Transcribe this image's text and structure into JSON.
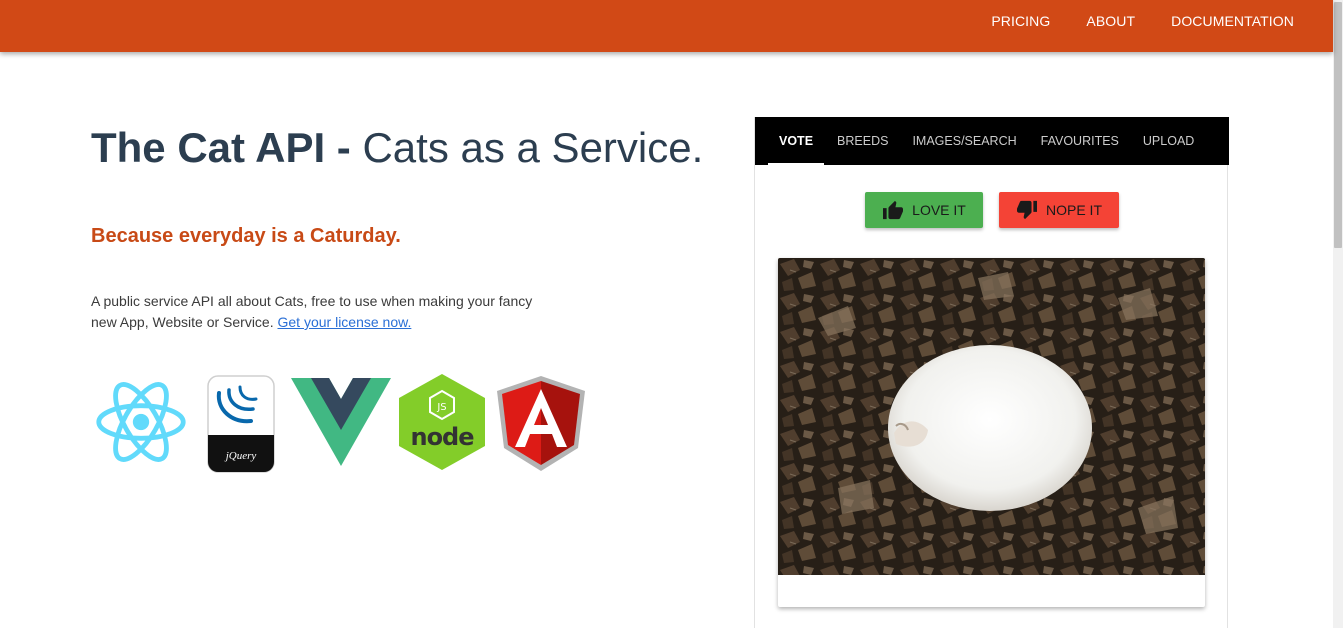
{
  "nav": {
    "items": [
      "PRICING",
      "ABOUT",
      "DOCUMENTATION"
    ]
  },
  "hero": {
    "title_bold": "The Cat API -",
    "title_light": "Cats as a Service.",
    "tagline": "Because everyday is a Caturday.",
    "description": "A public service API all about Cats, free to use when making your fancy new App, Website or Service.",
    "license_link": "Get your license now."
  },
  "logos": [
    "react-icon",
    "jquery-icon",
    "vue-icon",
    "nodejs-icon",
    "angular-icon"
  ],
  "panel": {
    "tabs": [
      "VOTE",
      "BREEDS",
      "IMAGES/SEARCH",
      "FAVOURITES",
      "UPLOAD"
    ],
    "active_tab": "VOTE",
    "love_label": "LOVE IT",
    "nope_label": "NOPE IT"
  },
  "colors": {
    "brand": "#d14916",
    "title": "#2c3e50",
    "tagline": "#c84a16",
    "love": "#4caf50",
    "nope": "#f44336"
  }
}
